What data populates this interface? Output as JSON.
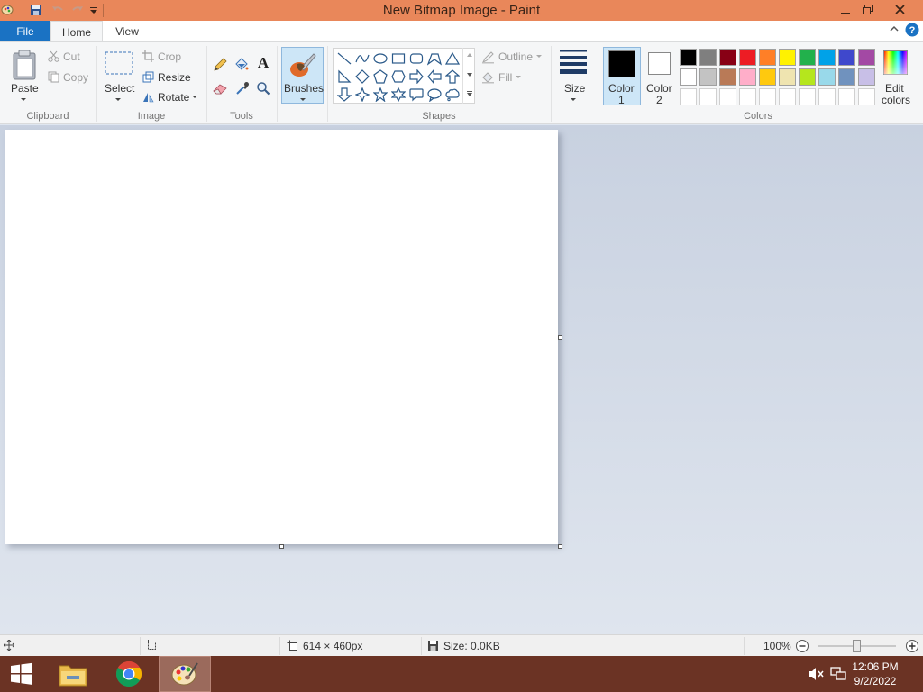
{
  "window": {
    "title": "New Bitmap Image - Paint"
  },
  "tabs": {
    "file": "File",
    "home": "Home",
    "view": "View"
  },
  "clipboard": {
    "paste": "Paste",
    "cut": "Cut",
    "copy": "Copy",
    "label": "Clipboard"
  },
  "image": {
    "select": "Select",
    "crop": "Crop",
    "resize": "Resize",
    "rotate": "Rotate",
    "label": "Image"
  },
  "tools": {
    "label": "Tools",
    "text_glyph": "A"
  },
  "brushes": {
    "label": "Brushes"
  },
  "shapes": {
    "outline": "Outline",
    "fill": "Fill",
    "label": "Shapes"
  },
  "size": {
    "label": "Size"
  },
  "colors": {
    "color1_label": "Color",
    "color1_num": "1",
    "color2_label": "Color",
    "color2_num": "2",
    "edit_label_1": "Edit",
    "edit_label_2": "colors",
    "label": "Colors",
    "color1": "#000000",
    "color2": "#ffffff",
    "palette_row1": [
      "#000000",
      "#7f7f7f",
      "#880015",
      "#ed1c24",
      "#ff7f27",
      "#fff200",
      "#22b14c",
      "#00a2e8",
      "#3f48cc",
      "#a349a4"
    ],
    "palette_row2": [
      "#ffffff",
      "#c3c3c3",
      "#b97a57",
      "#ffaec9",
      "#ffc90e",
      "#efe4b0",
      "#b5e61d",
      "#99d9ea",
      "#7092be",
      "#c8bfe7"
    ]
  },
  "status": {
    "dimensions": "614 × 460px",
    "size": "Size: 0.0KB",
    "zoom": "100%"
  },
  "taskbar": {
    "time": "12:06 PM",
    "date": "9/2/2022"
  }
}
